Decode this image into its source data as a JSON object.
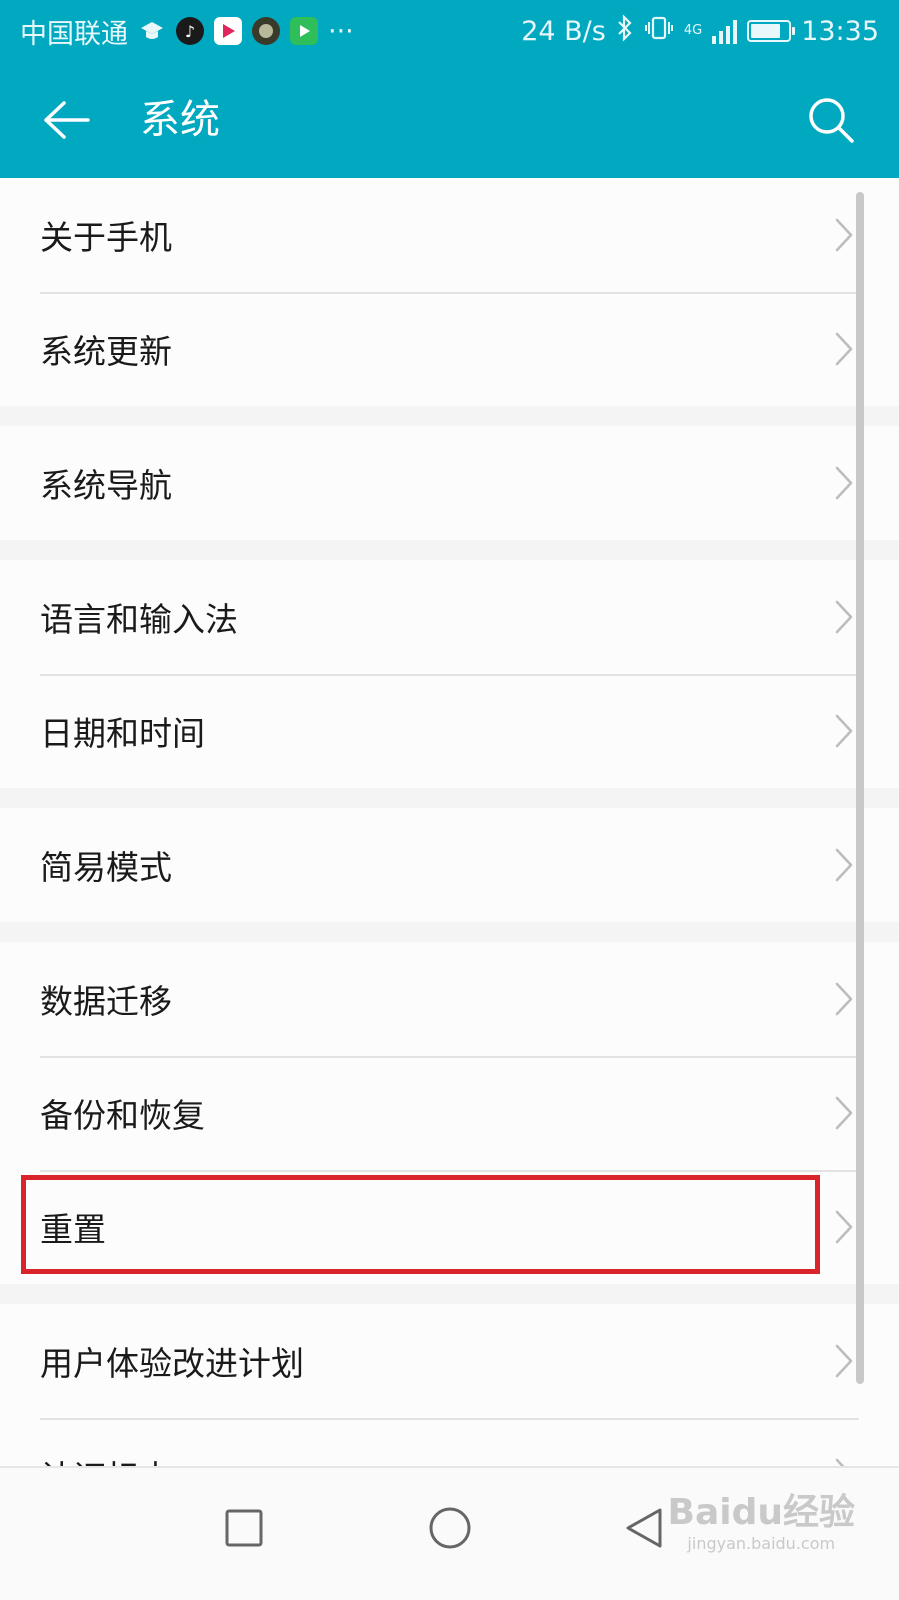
{
  "status_bar": {
    "carrier": "中国联通",
    "more": "···",
    "network_speed": "24 B/s",
    "network_type": "4G",
    "time": "13:35",
    "battery_percent": 80
  },
  "toolbar": {
    "title": "系统"
  },
  "groups": [
    {
      "items": [
        {
          "label": "关于手机"
        },
        {
          "label": "系统更新"
        }
      ]
    },
    {
      "items": [
        {
          "label": "系统导航"
        }
      ]
    },
    {
      "items": [
        {
          "label": "语言和输入法"
        },
        {
          "label": "日期和时间"
        }
      ]
    },
    {
      "items": [
        {
          "label": "简易模式"
        }
      ]
    },
    {
      "items": [
        {
          "label": "数据迁移"
        },
        {
          "label": "备份和恢复"
        },
        {
          "label": "重置",
          "highlighted": true
        }
      ]
    },
    {
      "items": [
        {
          "label": "用户体验改进计划"
        },
        {
          "label": "认证标志"
        }
      ]
    }
  ],
  "watermark": {
    "logo": "Baidu经验",
    "url": "jingyan.baidu.com"
  },
  "colors": {
    "accent": "#00a8c0",
    "highlight": "#d9242b"
  },
  "icons": {
    "back": "back-arrow-icon",
    "search": "search-icon",
    "chevron": "chevron-right-icon",
    "recents": "square-icon",
    "home": "circle-icon",
    "nav_back": "triangle-back-icon"
  }
}
